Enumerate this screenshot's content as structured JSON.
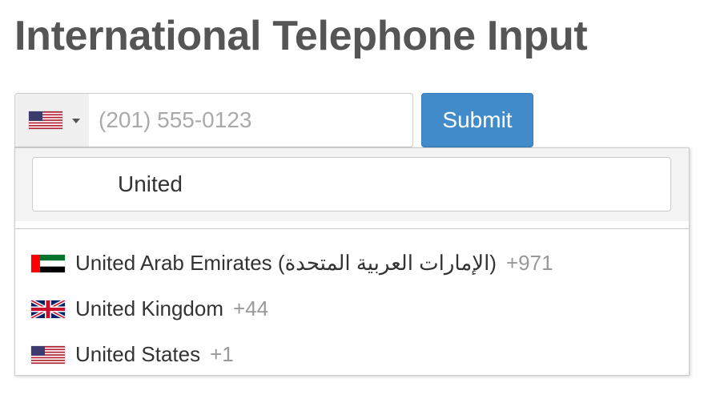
{
  "page": {
    "title": "International Telephone Input"
  },
  "phone_field": {
    "selected_flag_icon": "us-flag-icon",
    "placeholder": "(201) 555-0123",
    "value": ""
  },
  "submit_button": {
    "label": "Submit",
    "color": "#428bca"
  },
  "country_dropdown": {
    "search_value": "United",
    "countries": [
      {
        "name": "United Arab Emirates (الإمارات العربية المتحدة)",
        "dial_code": "+971",
        "flag_icon": "ae-flag-icon"
      },
      {
        "name": "United Kingdom",
        "dial_code": "+44",
        "flag_icon": "gb-flag-icon"
      },
      {
        "name": "United States",
        "dial_code": "+1",
        "flag_icon": "us-flag-icon"
      }
    ]
  }
}
